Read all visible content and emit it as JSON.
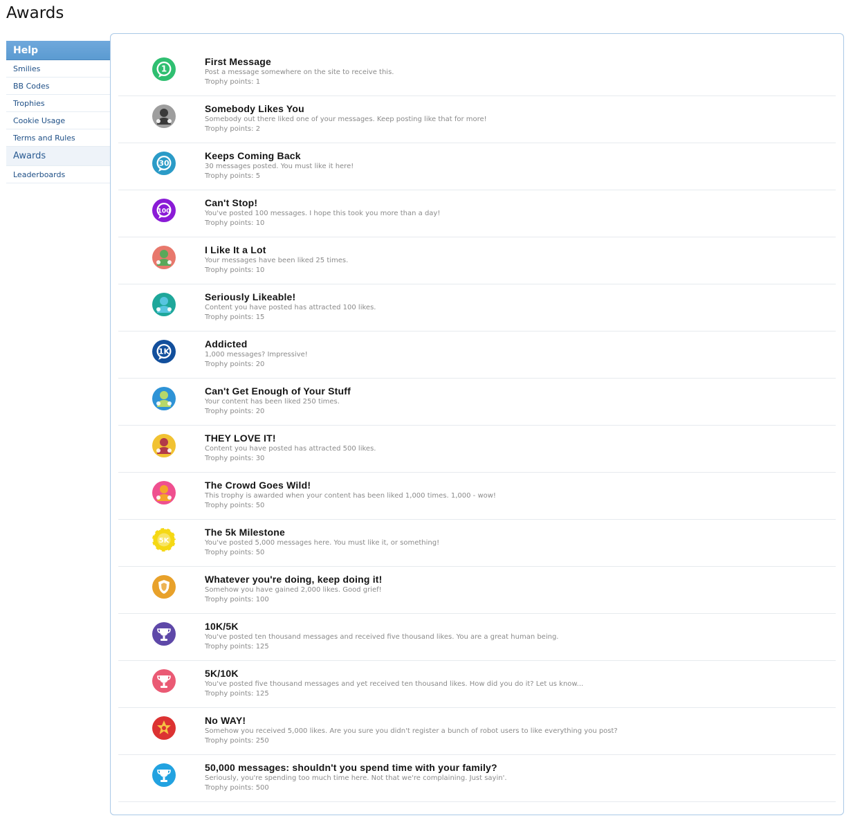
{
  "page": {
    "title": "Awards"
  },
  "sidebar": {
    "header": "Help",
    "items": [
      {
        "label": "Smilies",
        "selected": false
      },
      {
        "label": "BB Codes",
        "selected": false
      },
      {
        "label": "Trophies",
        "selected": false
      },
      {
        "label": "Cookie Usage",
        "selected": false
      },
      {
        "label": "Terms and Rules",
        "selected": false
      },
      {
        "label": "Awards",
        "selected": true
      },
      {
        "label": "Leaderboards",
        "selected": false
      }
    ]
  },
  "awards": [
    {
      "title": "First Message",
      "description": "Post a message somewhere on the site to receive this.",
      "points": "Trophy points: 1",
      "icon": "speech-bubble-1-icon",
      "color": "#2fbf71",
      "glyph": "1"
    },
    {
      "title": "Somebody Likes You",
      "description": "Somebody out there liked one of your messages. Keep posting like that for more!",
      "points": "Trophy points: 2",
      "icon": "person-grey-icon",
      "color": "#8e8e8e",
      "glyph": ""
    },
    {
      "title": "Keeps Coming Back",
      "description": "30 messages posted. You must like it here!",
      "points": "Trophy points: 5",
      "icon": "speech-bubble-30-icon",
      "color": "#2b9bc7",
      "glyph": "30"
    },
    {
      "title": "Can't Stop!",
      "description": "You've posted 100 messages. I hope this took you more than a day!",
      "points": "Trophy points: 10",
      "icon": "speech-bubble-100-icon",
      "color": "#8a1bd6",
      "glyph": "100"
    },
    {
      "title": "I Like It a Lot",
      "description": "Your messages have been liked 25 times.",
      "points": "Trophy points: 10",
      "icon": "person-green-icon",
      "color": "#e8786c",
      "glyph": ""
    },
    {
      "title": "Seriously Likeable!",
      "description": "Content you have posted has attracted 100 likes.",
      "points": "Trophy points: 15",
      "icon": "person-teal-icon",
      "color": "#1ea79a",
      "glyph": ""
    },
    {
      "title": "Addicted",
      "description": "1,000 messages? Impressive!",
      "points": "Trophy points: 20",
      "icon": "speech-bubble-1k-icon",
      "color": "#124f9c",
      "glyph": "1K"
    },
    {
      "title": "Can't Get Enough of Your Stuff",
      "description": "Your content has been liked 250 times.",
      "points": "Trophy points: 20",
      "icon": "person-blue-icon",
      "color": "#2e93d6",
      "glyph": ""
    },
    {
      "title": "THEY LOVE IT!",
      "description": "Content you have posted has attracted 500 likes.",
      "points": "Trophy points: 30",
      "icon": "person-maroon-icon",
      "color": "#f1c232",
      "glyph": ""
    },
    {
      "title": "The Crowd Goes Wild!",
      "description": "This trophy is awarded when your content has been liked 1,000 times. 1,000 - wow!",
      "points": "Trophy points: 50",
      "icon": "person-orange-icon",
      "color": "#ef4f8f",
      "glyph": ""
    },
    {
      "title": "The 5k Milestone",
      "description": "You've posted 5,000 messages here. You must like it, or something!",
      "points": "Trophy points: 50",
      "icon": "poker-chip-5k-icon",
      "color": "#f5d814",
      "glyph": "5K"
    },
    {
      "title": "Whatever you're doing, keep doing it!",
      "description": "Somehow you have gained 2,000 likes. Good grief!",
      "points": "Trophy points: 100",
      "icon": "police-badge-icon",
      "color": "#e8a12a",
      "glyph": ""
    },
    {
      "title": "10K/5K",
      "description": "You've posted ten thousand messages and received five thousand likes. You are a great human being.",
      "points": "Trophy points: 125",
      "icon": "trophy-purple-icon",
      "color": "#5e48a8",
      "glyph": ""
    },
    {
      "title": "5K/10K",
      "description": "You've posted five thousand messages and yet received ten thousand likes. How did you do it? Let us know...",
      "points": "Trophy points: 125",
      "icon": "trophy-pink-icon",
      "color": "#ea5a74",
      "glyph": ""
    },
    {
      "title": "No WAY!",
      "description": "Somehow you received 5,000 likes. Are you sure you didn't register a bunch of robot users to like everything you post?",
      "points": "Trophy points: 250",
      "icon": "sheriff-badge-icon",
      "color": "#dc3232",
      "glyph": ""
    },
    {
      "title": "50,000 messages: shouldn't you spend time with your family?",
      "description": "Seriously, you're spending too much time here. Not that we're complaining. Just sayin'.",
      "points": "Trophy points: 500",
      "icon": "trophy-blue-icon",
      "color": "#22a2e0",
      "glyph": ""
    }
  ]
}
